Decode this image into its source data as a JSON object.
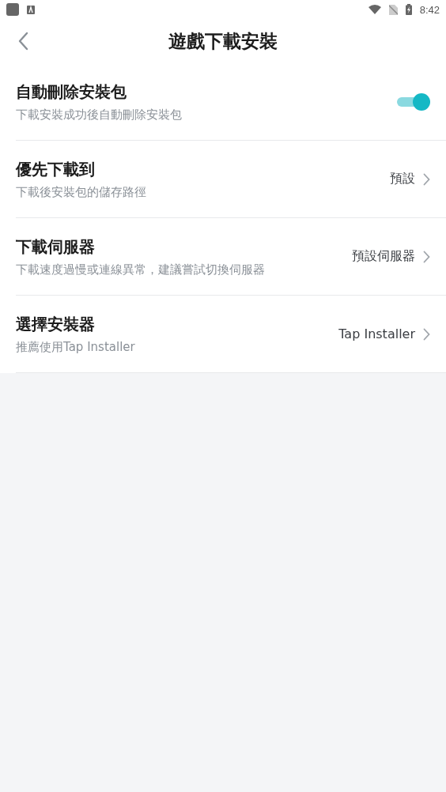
{
  "status_bar": {
    "time": "8:42"
  },
  "header": {
    "title": "遊戲下載安裝"
  },
  "settings": [
    {
      "kind": "toggle",
      "title": "自動刪除安裝包",
      "subtitle": "下載安裝成功後自動刪除安裝包",
      "on": true
    },
    {
      "kind": "link",
      "title": "優先下載到",
      "subtitle": "下載後安裝包的儲存路徑",
      "value": "預設"
    },
    {
      "kind": "link",
      "title": "下載伺服器",
      "subtitle": "下載速度過慢或連線異常，建議嘗試切換伺服器",
      "value": "預設伺服器"
    },
    {
      "kind": "link",
      "title": "選擇安裝器",
      "subtitle": "推薦使用Tap Installer",
      "value": "Tap Installer"
    }
  ]
}
